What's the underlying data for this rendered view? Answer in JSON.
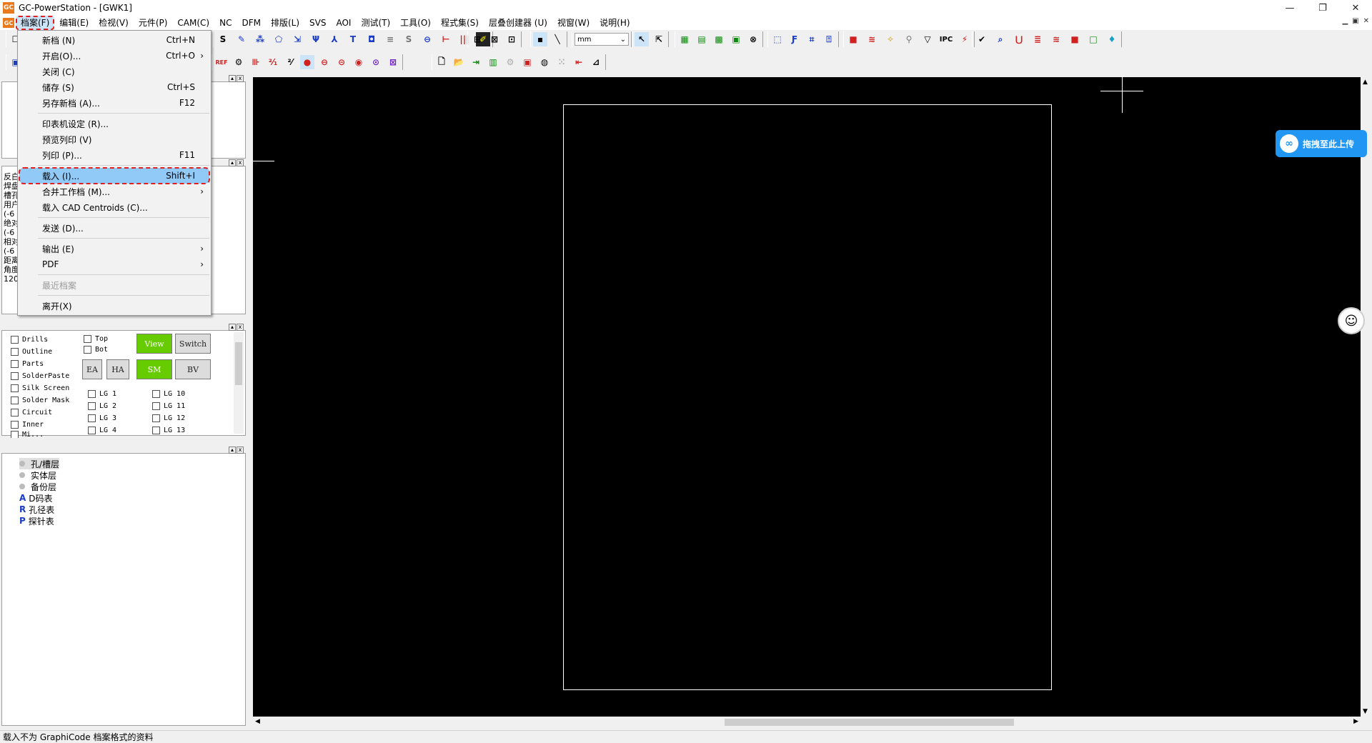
{
  "window": {
    "title": "GC-PowerStation - [GWK1]",
    "app_icon": "GC",
    "controls": [
      "—",
      "❐",
      "✕"
    ]
  },
  "menubar": {
    "items": [
      "档案(F)",
      "编辑(E)",
      "检视(V)",
      "元件(P)",
      "CAM(C)",
      "NC",
      "DFM",
      "排版(L)",
      "SVS",
      "AOI",
      "测试(T)",
      "工具(O)",
      "程式集(S)",
      "层叠创建器 (U)",
      "视窗(W)",
      "说明(H)"
    ]
  },
  "toolbar": {
    "units_select": "mm"
  },
  "file_menu": {
    "items": [
      {
        "label": "新档 (N)",
        "shortcut": "Ctrl+N"
      },
      {
        "label": "开启(O)...",
        "shortcut": "Ctrl+O"
      },
      {
        "label": "关闭 (C)",
        "shortcut": ""
      },
      {
        "label": "储存 (S)",
        "shortcut": "Ctrl+S"
      },
      {
        "label": "另存新档 (A)...",
        "shortcut": "F12"
      },
      {
        "label": "印表机设定 (R)...",
        "shortcut": ""
      },
      {
        "label": "预览列印 (V)",
        "shortcut": ""
      },
      {
        "label": "列印 (P)...",
        "shortcut": "F11"
      },
      {
        "label": "载入 (I)...",
        "shortcut": "Shift+I"
      },
      {
        "label": "合并工作档 (M)...",
        "shortcut": ""
      },
      {
        "label": "载入 CAD Centroids (C)...",
        "shortcut": ""
      },
      {
        "label": "发送 (D)...",
        "shortcut": ""
      },
      {
        "label": "输出 (E)",
        "shortcut": ""
      },
      {
        "label": "PDF",
        "shortcut": ""
      },
      {
        "label": "最近档案",
        "shortcut": ""
      },
      {
        "label": "离开(X)",
        "shortcut": ""
      }
    ]
  },
  "info_panel": {
    "lines": [
      "反白",
      "焊盘",
      "槽孔",
      "用户",
      "(-6",
      "绝对",
      "(-6",
      "相对",
      "(-6",
      "距离",
      "角度",
      "120"
    ]
  },
  "layer_panel": {
    "left_checks": [
      "Drills",
      "Outline",
      "Parts",
      "SolderPaste",
      "Silk Screen",
      "Solder Mask",
      "Circuit",
      "Inner",
      "Mi..."
    ],
    "side_checks": [
      "Top",
      "Bot"
    ],
    "buttons": {
      "view": "View",
      "switch": "Switch",
      "ea": "EA",
      "ha": "HA",
      "sm": "SM",
      "bv": "BV"
    },
    "lg_col1": [
      "LG 1",
      "LG 2",
      "LG 3",
      "LG 4"
    ],
    "lg_col2": [
      "LG 10",
      "LG 11",
      "LG 12",
      "LG 13"
    ]
  },
  "tree_panel": {
    "items": [
      "孔/槽层",
      "实体层",
      "备份层",
      "D码表",
      "孔径表",
      "探针表"
    ]
  },
  "upload_widget": {
    "label": "拖拽至此上传"
  },
  "statusbar": {
    "text": "载入不为 GraphiCode 档案格式的资料"
  }
}
